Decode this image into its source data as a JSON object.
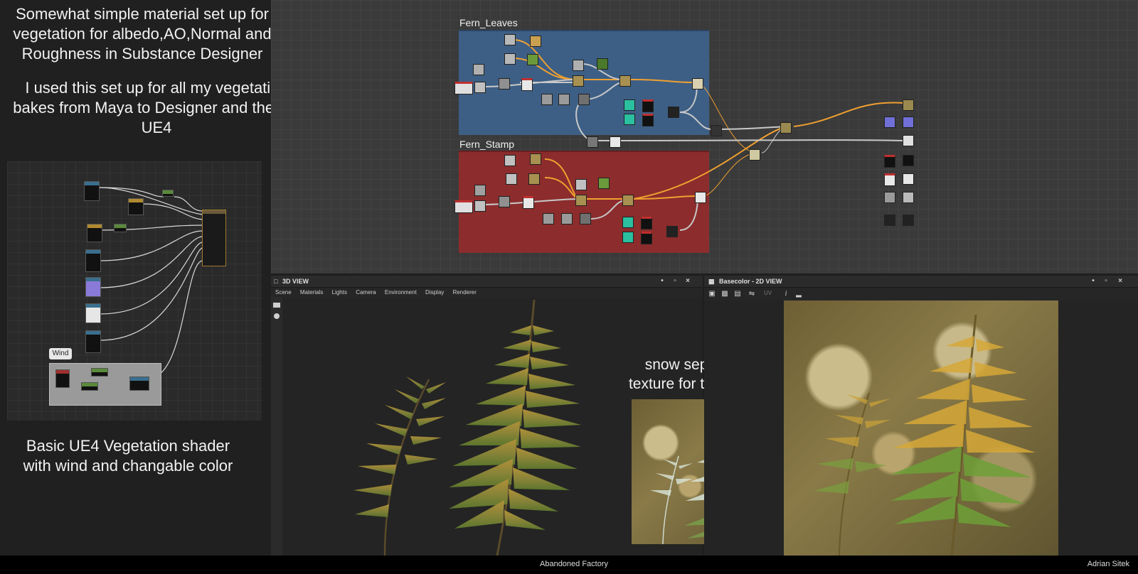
{
  "left_notes": {
    "intro_line1": "Somewhat simple material set up for",
    "intro_line2": "vegetation for albedo,AO,Normal and",
    "intro_line3": "Roughness in Substance Designer",
    "usage_line1": "I used this set up for all my vegetation",
    "usage_line2": "bakes from Maya to Designer and then to",
    "usage_line3": "UE4",
    "shader_line1": "Basic UE4 Vegetation shader",
    "shader_line2": "with wind and changable color",
    "wind_label": "Wind"
  },
  "graph": {
    "frames": [
      {
        "title": "Fern_Leaves",
        "color": "#3d5f85"
      },
      {
        "title": "Fern_Stamp",
        "color": "#8c2c2c"
      }
    ]
  },
  "view3d": {
    "title": "3D VIEW",
    "menu": [
      "Scene",
      "Materials",
      "Lights",
      "Camera",
      "Environment",
      "Display",
      "Renderer"
    ]
  },
  "view2d": {
    "title": "Basecolor - 2D VIEW",
    "uv_label": "UV"
  },
  "snow_note": {
    "line1": "snow separate",
    "line2": "texture for the ferns"
  },
  "footer": {
    "center": "Abandoned Factory",
    "right": "Adrian Sitek"
  },
  "colors": {
    "frame_leaves": "#3d5f85",
    "frame_stamp": "#8c2c2c",
    "wire_orange": "#f0a030",
    "wire_grey": "#c8c8c8"
  }
}
